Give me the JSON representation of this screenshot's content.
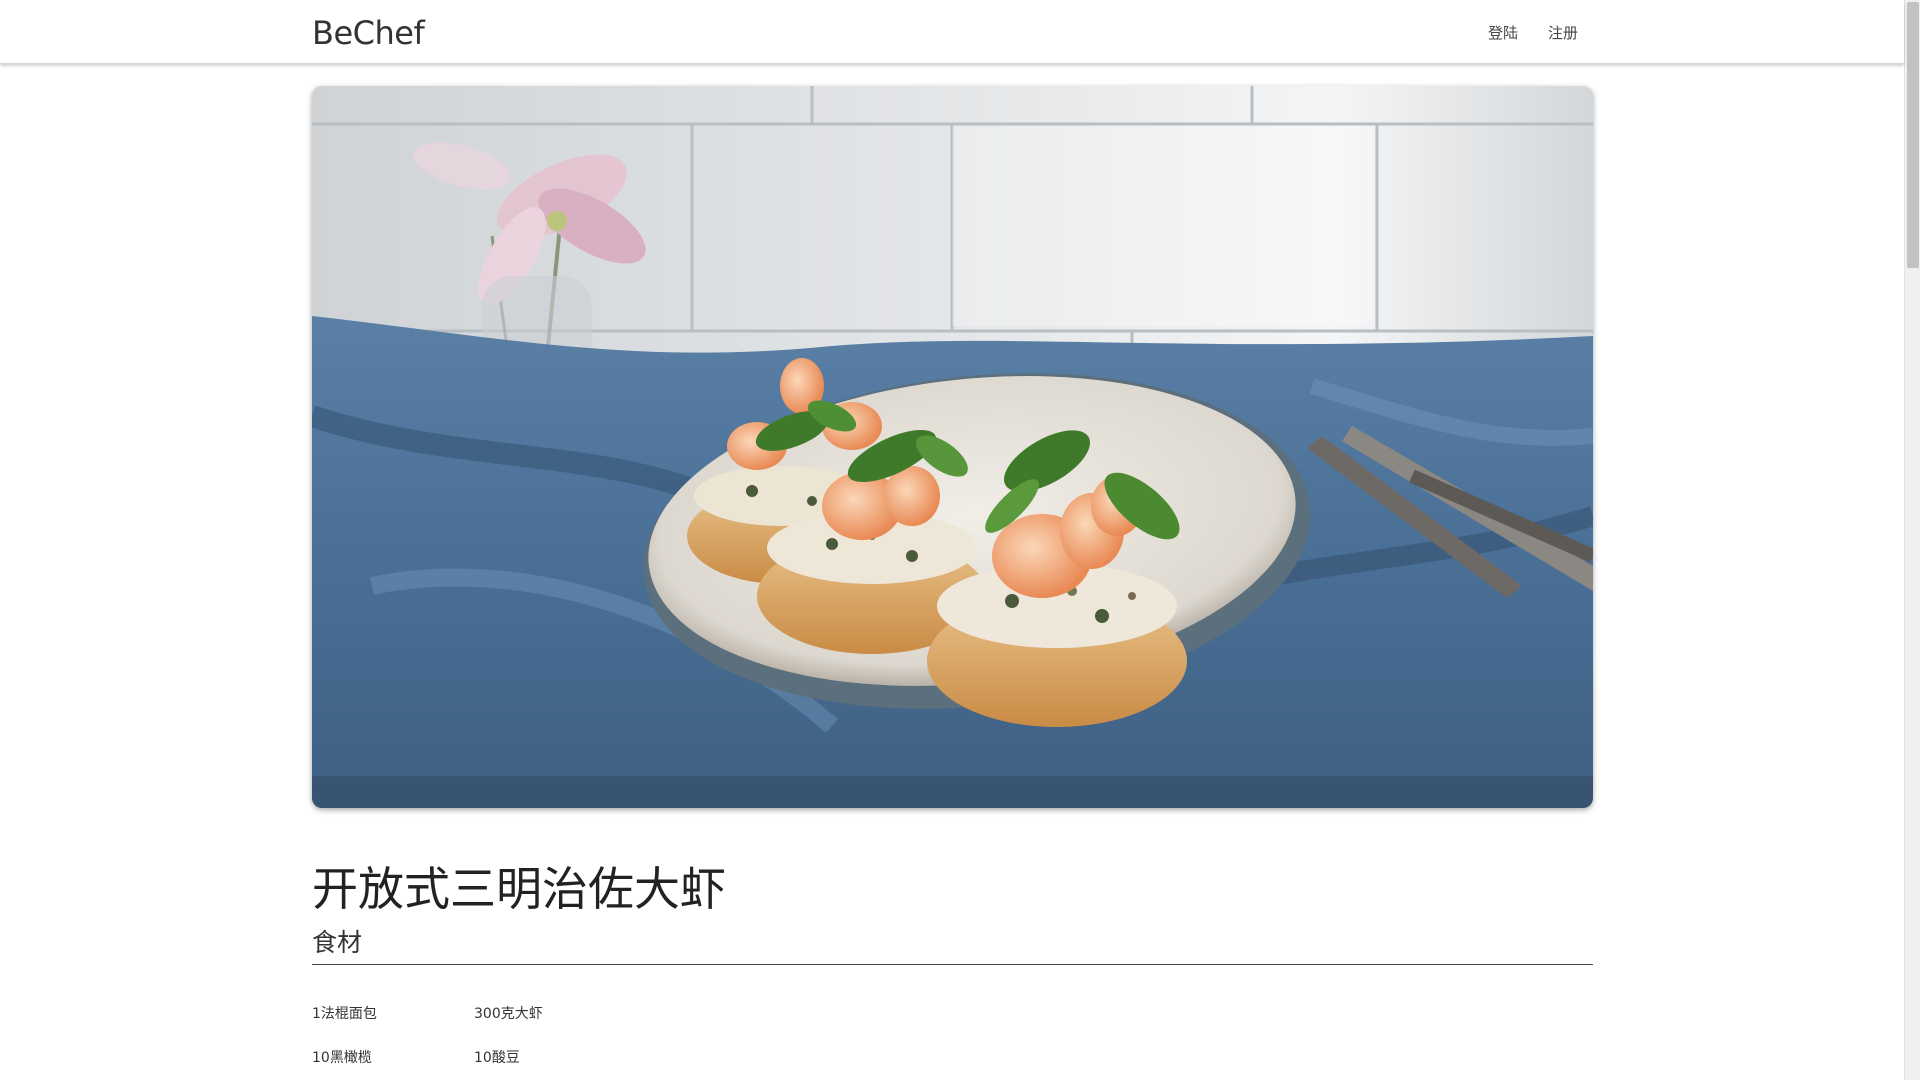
{
  "navbar": {
    "brand": "BeChef",
    "links": [
      {
        "label": "登陆"
      },
      {
        "label": "注册"
      }
    ]
  },
  "hero": {
    "alt": "开放式三明治佐大虾",
    "description_icon": "recipe-photo"
  },
  "recipe": {
    "title": "开放式三明治佐大虾",
    "ingredients_heading": "食材",
    "ingredients": [
      "1法棍面包",
      "300克大虾",
      "10黑橄榄",
      "10酸豆"
    ]
  },
  "colors": {
    "text": "#333333",
    "navbar_border": "#d8d8d8",
    "tablecloth": "#4f77a0",
    "tile_wall": "#d9dde1",
    "plate": "#e8e4dc"
  }
}
